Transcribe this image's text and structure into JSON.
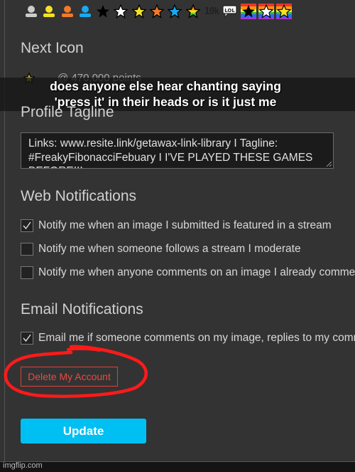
{
  "icon_bar": [
    {
      "icon": "user-gray-icon",
      "color": "#cccccc"
    },
    {
      "icon": "user-yellow-icon",
      "color": "#f5e025"
    },
    {
      "icon": "user-orange-icon",
      "color": "#f07a2a"
    },
    {
      "icon": "user-blue-icon",
      "color": "#1aa9f0"
    },
    {
      "icon": "star-black-icon",
      "color": "#000000"
    },
    {
      "icon": "star-white-icon",
      "color": "#ffffff"
    },
    {
      "icon": "star-yellow-icon",
      "color": "#f2e227"
    },
    {
      "icon": "star-orange-icon",
      "color": "#f07a2a"
    },
    {
      "icon": "star-blue-icon",
      "color": "#1aa9f0"
    },
    {
      "icon": "star-rainbow-icon",
      "color": "rainbow"
    },
    {
      "icon": "10k-icon",
      "text": "10k"
    },
    {
      "icon": "lol-bubble-icon",
      "text": "LOL"
    },
    {
      "icon": "rainbow-star-black-icon",
      "color": "#000000"
    },
    {
      "icon": "rainbow-star-white-icon",
      "color": "#ffffff"
    },
    {
      "icon": "rainbow-star-yellow-icon",
      "color": "#f2e227"
    }
  ],
  "next_icon": {
    "heading": "Next Icon",
    "icon": "star-yellow-icon",
    "points_label": "@ 470,000 points"
  },
  "caption": {
    "line1": "does anyone else hear chanting saying",
    "line2": "'press it' in their heads or is it just me"
  },
  "profile_tagline": {
    "heading": "Profile Tagline",
    "value": "Links: www.resite.link/getawax-link-library I Tagline: #FreakyFibonacciFebuary I I'VE PLAYED THESE GAMES BEFORE!!!"
  },
  "web_notifications": {
    "heading": "Web Notifications",
    "options": [
      {
        "label": "Notify me when an image I submitted is featured in a stream",
        "checked": true
      },
      {
        "label": "Notify me when someone follows a stream I moderate",
        "checked": false
      },
      {
        "label": "Notify me when anyone comments on an image I already commented on",
        "checked": false
      }
    ]
  },
  "email_notifications": {
    "heading": "Email Notifications",
    "options": [
      {
        "label": "Email me if someone comments on my image, replies to my comment",
        "checked": true
      }
    ]
  },
  "buttons": {
    "delete_account": "Delete My Account",
    "update": "Update"
  },
  "colors": {
    "background": "#333333",
    "accent": "#00bff3",
    "danger": "#e84a44",
    "scribble": "#ff1a1a"
  },
  "watermark": "imgflip.com"
}
